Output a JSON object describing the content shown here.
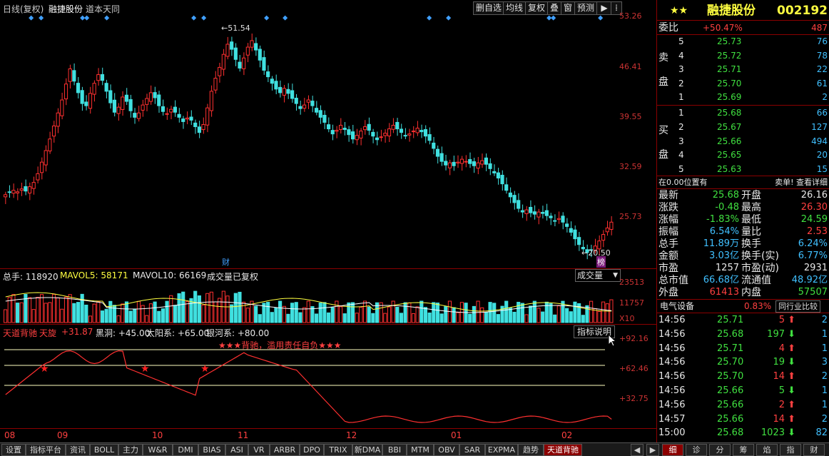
{
  "topbar": {
    "chart_title": "日线(复权)",
    "stock_name": "融捷股份",
    "indicator_source": "道本天同",
    "buttons": [
      "删自选",
      "均线",
      "复权",
      "叠",
      "窗",
      "预测"
    ],
    "play_icon": "play-icon"
  },
  "kline": {
    "price_axis": [
      "53.26",
      "46.41",
      "39.55",
      "32.59",
      "25.73"
    ],
    "high_marker": "51.54",
    "low_marker": "20.50",
    "cai_label": "财",
    "bang_label": "榜"
  },
  "volume": {
    "legend_total": "总手: 118920",
    "legend_mavol5": "MAVOL5: 58171",
    "legend_mavol10": "MAVOL10: 66169",
    "legend_note": "成交量已复权",
    "dropdown_value": "成交量",
    "axis": [
      "23513",
      "11757",
      "X10"
    ]
  },
  "indicator": {
    "name": "天道背驰",
    "sub": "天旋",
    "value": "+31.87",
    "black_hole": "黑洞: +45.00",
    "sun_system": "太阳系: +65.00",
    "galaxy": "银河系: +80.00",
    "warning": "★★★背驰，滥用责任自负★★★",
    "help_button": "指标说明",
    "axis": [
      "+92.16",
      "+62.46",
      "+32.75"
    ]
  },
  "date_axis": [
    "08",
    "09",
    "10",
    "11",
    "12",
    "01",
    "02"
  ],
  "tabs": [
    "设置",
    "指标平台",
    "资讯",
    "BOLL",
    "主力",
    "W&R",
    "DMI",
    "BIAS",
    "ASI",
    "VR",
    "ARBR",
    "DPO",
    "TRIX",
    "新DMA",
    "BBI",
    "MTM",
    "OBV",
    "SAR",
    "EXPMA",
    "趋势",
    "天道背驰"
  ],
  "right_tabs": [
    "细",
    "诊",
    "分",
    "筹",
    "焰",
    "指",
    "财"
  ],
  "panel": {
    "stars": "★★",
    "name": "融捷股份",
    "code": "002192",
    "weibi_label": "委比",
    "weibi_value": "+50.47%",
    "weicha_value": "487",
    "sell_label": [
      "卖",
      "盘"
    ],
    "buy_label": [
      "买",
      "盘"
    ],
    "sell": [
      {
        "level": "5",
        "price": "25.73",
        "vol": "76"
      },
      {
        "level": "4",
        "price": "25.72",
        "vol": "78"
      },
      {
        "level": "3",
        "price": "25.71",
        "vol": "22"
      },
      {
        "level": "2",
        "price": "25.70",
        "vol": "61"
      },
      {
        "level": "1",
        "price": "25.69",
        "vol": "2"
      }
    ],
    "buy": [
      {
        "level": "1",
        "price": "25.68",
        "vol": "66"
      },
      {
        "level": "2",
        "price": "25.67",
        "vol": "127"
      },
      {
        "level": "3",
        "price": "25.66",
        "vol": "494"
      },
      {
        "level": "4",
        "price": "25.65",
        "vol": "20"
      },
      {
        "level": "5",
        "price": "25.63",
        "vol": "15"
      }
    ],
    "position_line": "在0.00位置有",
    "detail_link": "卖单! 查看详细",
    "quote": [
      {
        "l1": "最新",
        "v1": "25.68",
        "l2": "开盘",
        "v2": "26.16"
      },
      {
        "l1": "涨跌",
        "v1": "-0.48",
        "l2": "最高",
        "v2": "26.30"
      },
      {
        "l1": "涨幅",
        "v1": "-1.83%",
        "l2": "最低",
        "v2": "24.59"
      },
      {
        "l1": "振幅",
        "v1": "6.54%",
        "l2": "量比",
        "v2": "2.53"
      },
      {
        "l1": "总手",
        "v1": "11.89万",
        "l2": "换手",
        "v2": "6.24%"
      },
      {
        "l1": "金额",
        "v1": "3.03亿",
        "l2": "换手(实)",
        "v2": "6.77%"
      },
      {
        "l1": "市盈",
        "v1": "1257",
        "l2": "市盈(动)",
        "v2": "2931"
      },
      {
        "l1": "总市值",
        "v1": "66.68亿",
        "l2": "流通值",
        "v2": "48.92亿"
      },
      {
        "l1": "外盘",
        "v1": "61413",
        "l2": "内盘",
        "v2": "57507"
      }
    ],
    "industry": "电气设备",
    "industry_pct": "0.83%",
    "industry_button": "同行业比较",
    "ticks": [
      {
        "time": "14:56",
        "price": "25.71",
        "vol": "5",
        "dir": "up",
        "n": "2"
      },
      {
        "time": "14:56",
        "price": "25.68",
        "vol": "197",
        "dir": "down",
        "n": "1"
      },
      {
        "time": "14:56",
        "price": "25.71",
        "vol": "4",
        "dir": "up",
        "n": "1"
      },
      {
        "time": "14:56",
        "price": "25.70",
        "vol": "19",
        "dir": "down",
        "n": "3"
      },
      {
        "time": "14:56",
        "price": "25.70",
        "vol": "14",
        "dir": "up",
        "n": "2"
      },
      {
        "time": "14:56",
        "price": "25.66",
        "vol": "5",
        "dir": "down",
        "n": "1"
      },
      {
        "time": "14:56",
        "price": "25.66",
        "vol": "2",
        "dir": "up",
        "n": "1"
      },
      {
        "time": "14:57",
        "price": "25.66",
        "vol": "14",
        "dir": "up",
        "n": "2"
      },
      {
        "time": "15:00",
        "price": "25.68",
        "vol": "1023",
        "dir": "down",
        "n": "82"
      }
    ]
  },
  "colors": {
    "up": "#ff4040",
    "down": "#40e0e0",
    "bg": "#000000",
    "border": "#8b0000"
  }
}
